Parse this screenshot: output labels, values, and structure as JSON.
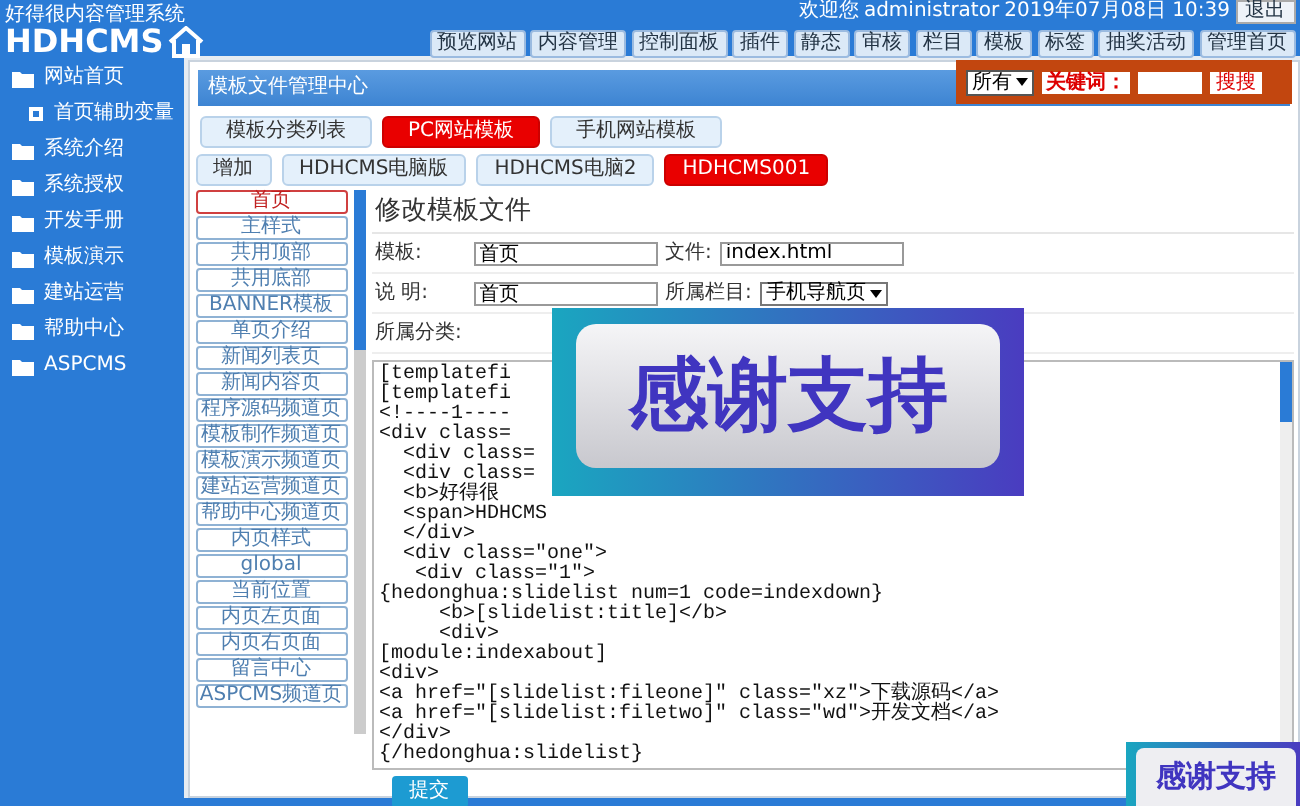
{
  "logo": {
    "subtitle": "好得很内容管理系统",
    "title": "HDHCMS"
  },
  "user_bar": {
    "welcome": "欢迎您",
    "user": "administrator",
    "datetime": "2019年07月08日 10:39",
    "logout": "退出"
  },
  "top_nav": [
    "预览网站",
    "内容管理",
    "控制面板",
    "插件",
    "静态",
    "审核",
    "栏目",
    "模板",
    "标签",
    "抽奖活动",
    "管理首页"
  ],
  "sidebar": {
    "items": [
      {
        "label": "网站首页",
        "children": [
          {
            "label": "首页辅助变量"
          }
        ]
      },
      {
        "label": "系统介绍"
      },
      {
        "label": "系统授权"
      },
      {
        "label": "开发手册"
      },
      {
        "label": "模板演示"
      },
      {
        "label": "建站运营"
      },
      {
        "label": "帮助中心"
      },
      {
        "label": "ASPCMS"
      }
    ]
  },
  "panel": {
    "title": "模板文件管理中心"
  },
  "search": {
    "scope": "所有",
    "keyword_label": "关键词：",
    "button": "搜搜"
  },
  "tabs": [
    {
      "label": "模板分类列表",
      "selected": false
    },
    {
      "label": "PC网站模板",
      "selected": true
    },
    {
      "label": "手机网站模板",
      "selected": false
    }
  ],
  "template_tabs": [
    {
      "label": "增加",
      "selected": false
    },
    {
      "label": "HDHCMS电脑版",
      "selected": false
    },
    {
      "label": "HDHCMS电脑2",
      "selected": false
    },
    {
      "label": "HDHCMS001",
      "selected": true
    }
  ],
  "file_list": [
    {
      "label": "首页",
      "selected": true
    },
    {
      "label": "主样式",
      "selected": false
    },
    {
      "label": "共用顶部",
      "selected": false
    },
    {
      "label": "共用底部",
      "selected": false
    },
    {
      "label": "BANNER模板",
      "selected": false
    },
    {
      "label": "单页介绍",
      "selected": false
    },
    {
      "label": "新闻列表页",
      "selected": false
    },
    {
      "label": "新闻内容页",
      "selected": false
    },
    {
      "label": "程序源码频道页",
      "selected": false
    },
    {
      "label": "模板制作频道页",
      "selected": false
    },
    {
      "label": "模板演示频道页",
      "selected": false
    },
    {
      "label": "建站运营频道页",
      "selected": false
    },
    {
      "label": "帮助中心频道页",
      "selected": false
    },
    {
      "label": "内页样式",
      "selected": false
    },
    {
      "label": "global",
      "selected": false
    },
    {
      "label": "当前位置",
      "selected": false
    },
    {
      "label": "内页左页面",
      "selected": false
    },
    {
      "label": "内页右页面",
      "selected": false
    },
    {
      "label": "留言中心",
      "selected": false
    },
    {
      "label": "ASPCMS频道页",
      "selected": false
    }
  ],
  "editor": {
    "heading": "修改模板文件",
    "rows": [
      [
        {
          "label": "模板:",
          "kind": "input",
          "value": "首页"
        },
        {
          "label": "文件:",
          "kind": "input",
          "value": "index.html"
        }
      ],
      [
        {
          "label": "说 明:",
          "kind": "input",
          "value": "首页"
        },
        {
          "label": "所属栏目:",
          "kind": "select",
          "value": "手机导航页"
        }
      ],
      [
        {
          "label": "所属分类:",
          "kind": "label"
        }
      ]
    ],
    "code_lines": [
      "[templatefi",
      "[templatefi",
      "<!----1----",
      "<div class=",
      "  <div class=",
      "  <div class=",
      "  <b>好得很",
      "  <span>HDHCMS",
      "  </div>",
      "  <div class=\"one\">",
      "   <div class=\"1\">",
      "{hedonghua:slidelist num=1 code=indexdown}",
      "     <b>[slidelist:title]</b>",
      "     <div>",
      "[module:indexabout]",
      "<div>",
      "<a href=\"[slidelist:fileone]\" class=\"xz\">下载源码</a>",
      "<a href=\"[slidelist:filetwo]\" class=\"wd\">开发文档</a>",
      "</div>",
      "{/hedonghua:slidelist}"
    ],
    "submit": "提交"
  },
  "overlays": [
    {
      "text": "感谢支持"
    },
    {
      "text": "感谢支持"
    }
  ]
}
